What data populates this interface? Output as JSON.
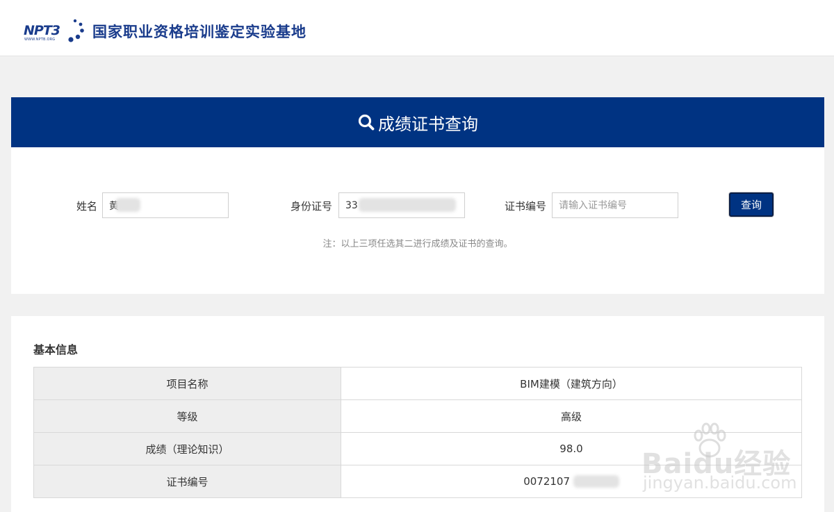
{
  "header": {
    "logo_text": "NPT3",
    "logo_sub": "WWW.NPTB.ORG",
    "site_title": "国家职业资格培训鉴定实验基地"
  },
  "query": {
    "title": "成绩证书查询",
    "name_label": "姓名",
    "name_value": "黄",
    "id_label": "身份证号",
    "id_value": "33",
    "cert_label": "证书编号",
    "cert_placeholder": "请输入证书编号",
    "button_label": "查询",
    "note": "注：以上三项任选其二进行成绩及证书的查询。"
  },
  "result": {
    "section_title": "基本信息",
    "rows": [
      {
        "key": "项目名称",
        "value": "BIM建模（建筑方向）"
      },
      {
        "key": "等级",
        "value": "高级"
      },
      {
        "key": "成绩（理论知识）",
        "value": "98.0"
      },
      {
        "key": "证书编号",
        "value": "0072107"
      }
    ]
  },
  "watermark": {
    "brand": "Baidu经验",
    "url": "jingyan.baidu.com"
  },
  "colors": {
    "primary": "#003382",
    "logo_blue": "#1a3c8c",
    "page_bg": "#f1f1f1",
    "table_key_bg": "#eeeeee"
  }
}
